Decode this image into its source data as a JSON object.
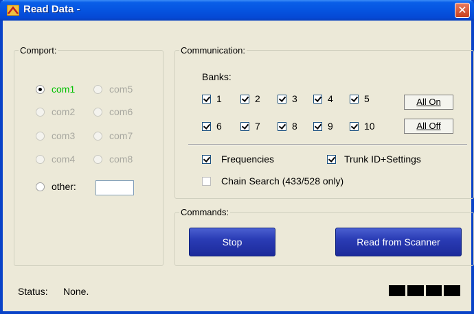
{
  "window": {
    "title": "Read Data -",
    "close_glyph": "✕"
  },
  "comport": {
    "legend": "Comport:",
    "options": [
      {
        "label": "com1",
        "selected": true,
        "enabled": true
      },
      {
        "label": "com5",
        "selected": false,
        "enabled": false
      },
      {
        "label": "com2",
        "selected": false,
        "enabled": false
      },
      {
        "label": "com6",
        "selected": false,
        "enabled": false
      },
      {
        "label": "com3",
        "selected": false,
        "enabled": false
      },
      {
        "label": "com7",
        "selected": false,
        "enabled": false
      },
      {
        "label": "com4",
        "selected": false,
        "enabled": false
      },
      {
        "label": "com8",
        "selected": false,
        "enabled": false
      }
    ],
    "other_label": "other:",
    "other_value": ""
  },
  "communication": {
    "legend": "Communication:",
    "banks_label": "Banks:",
    "banks": [
      "1",
      "2",
      "3",
      "4",
      "5",
      "6",
      "7",
      "8",
      "9",
      "10"
    ],
    "all_on_label": "All On",
    "all_off_label": "All Off",
    "frequencies_label": "Frequencies",
    "trunk_label": "Trunk ID+Settings",
    "chain_label": "Chain Search (433/528 only)",
    "frequencies_checked": true,
    "trunk_checked": true,
    "chain_checked": false
  },
  "commands": {
    "legend": "Commands:",
    "stop_label": "Stop",
    "read_label": "Read from Scanner"
  },
  "status": {
    "label": "Status:",
    "value": "None."
  },
  "colors": {
    "title_blue": "#0554e0",
    "selected_green": "#00c000",
    "button_blue": "#2a3cb5"
  }
}
